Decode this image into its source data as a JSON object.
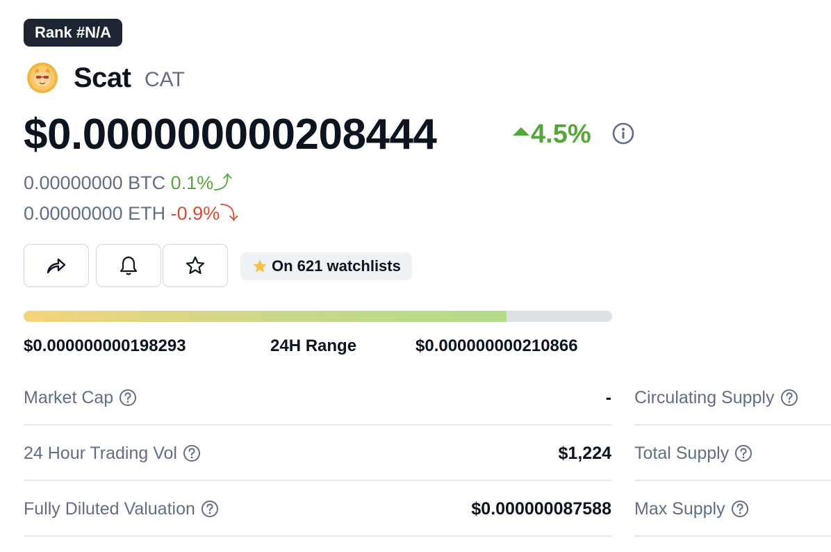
{
  "header": {
    "rank_badge": "Rank #N/A",
    "coin_name": "Scat",
    "coin_symbol": "CAT",
    "logo_icon": "cat-coin-logo-icon"
  },
  "price": {
    "usd": "$0.000000000208444",
    "change_24h": "4.5%",
    "change_direction": "up",
    "info_icon": "info-icon",
    "btc_value": "0.00000000 BTC",
    "btc_change": "0.1%",
    "btc_arrow": "⤴",
    "eth_value": "0.00000000 ETH",
    "eth_change": "-0.9%",
    "eth_arrow": "⤵"
  },
  "actions": {
    "share_icon": "share-icon",
    "alert_icon": "bell-icon",
    "watchlist_icon": "star-icon",
    "watchlist_count_text": "On 621 watchlists"
  },
  "range_24h": {
    "low": "$0.000000000198293",
    "label": "24H Range",
    "high": "$0.000000000210866",
    "fill_fraction": 0.82
  },
  "stats": [
    {
      "label": "Market Cap",
      "value": "-"
    },
    {
      "label": "24 Hour Trading Vol",
      "value": "$1,224"
    },
    {
      "label": "Fully Diluted Valuation",
      "value": "$0.000000087588"
    }
  ],
  "supply": [
    {
      "label": "Circulating Supply"
    },
    {
      "label": "Total Supply"
    },
    {
      "label": "Max Supply"
    }
  ],
  "colors": {
    "positive": "#57a63b",
    "negative": "#db4d33",
    "muted_text": "#616e85",
    "badge_bg": "#1e2532"
  }
}
